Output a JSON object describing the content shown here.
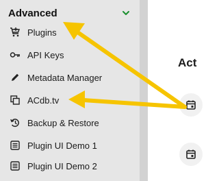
{
  "sidebar": {
    "section_title": "Advanced",
    "items": [
      {
        "label": "Plugins",
        "icon": "plugins-icon"
      },
      {
        "label": "API Keys",
        "icon": "key-icon"
      },
      {
        "label": "Metadata Manager",
        "icon": "pencil-icon"
      },
      {
        "label": "ACdb.tv",
        "icon": "copy-icon"
      },
      {
        "label": "Backup & Restore",
        "icon": "restore-icon"
      },
      {
        "label": "Plugin UI Demo 1",
        "icon": "list-icon"
      },
      {
        "label": "Plugin UI Demo 2",
        "icon": "list-icon"
      }
    ]
  },
  "main": {
    "heading": "Act"
  },
  "colors": {
    "accent_green": "#1a8f2e",
    "annotation_arrow": "#f6c400",
    "sidebar_bg": "#e6e6e6"
  }
}
